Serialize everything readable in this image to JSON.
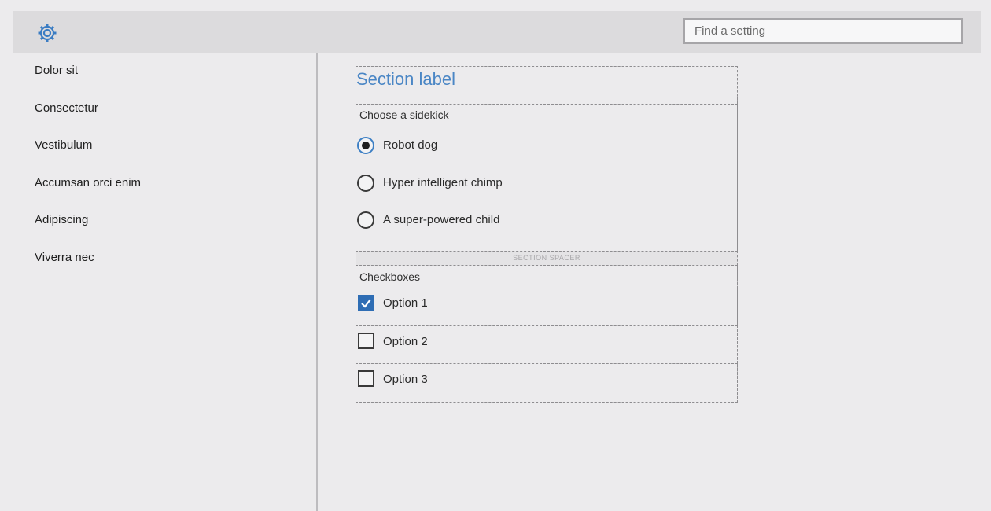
{
  "header": {
    "icon": "gear-icon",
    "search_placeholder": "Find a setting"
  },
  "sidebar": {
    "items": [
      {
        "label": "Dolor sit"
      },
      {
        "label": "Consectetur"
      },
      {
        "label": "Vestibulum"
      },
      {
        "label": "Accumsan orci enim"
      },
      {
        "label": "Adipiscing"
      },
      {
        "label": "Viverra nec"
      }
    ]
  },
  "main": {
    "section_label": "Section label",
    "radio_group": {
      "label": "Choose a sidekick",
      "options": [
        {
          "label": "Robot dog",
          "selected": true
        },
        {
          "label": "Hyper intelligent chimp",
          "selected": false
        },
        {
          "label": "A super-powered child",
          "selected": false
        }
      ]
    },
    "spacer_label": "SECTION SPACER",
    "checkbox_group": {
      "label": "Checkboxes",
      "options": [
        {
          "label": "Option 1",
          "checked": true
        },
        {
          "label": "Option 2",
          "checked": false
        },
        {
          "label": "Option 3",
          "checked": false
        }
      ]
    }
  },
  "colors": {
    "accent": "#4a86c5",
    "checkbox_fill": "#2e6db4",
    "background": "#ecebed",
    "topbar": "#dcdbdd"
  }
}
